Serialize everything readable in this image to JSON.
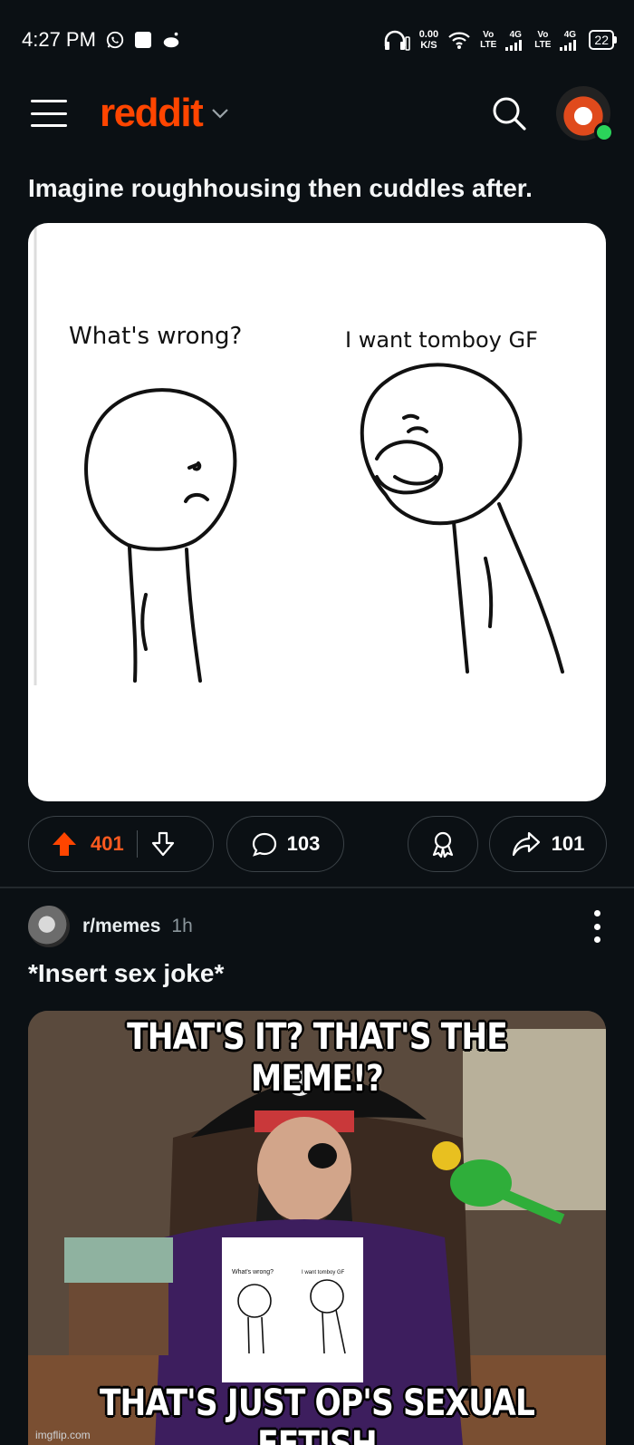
{
  "status": {
    "time": "4:27 PM",
    "speed_value": "0.00",
    "speed_unit": "K/S",
    "net1_top": "Vo",
    "net1_bottom": "LTE",
    "net1_gen": "4G",
    "net2_top": "Vo",
    "net2_bottom": "LTE",
    "net2_gen": "4G",
    "battery": "22"
  },
  "appbar": {
    "logo": "reddit",
    "icons": [
      "menu-icon",
      "chevron-down-icon",
      "search-icon",
      "avatar"
    ]
  },
  "post1": {
    "title": "Imagine roughhousing then cuddles after.",
    "image_caption_left": "What's wrong?",
    "image_caption_right": "I want tomboy GF",
    "upvotes": "401",
    "comments": "103",
    "shares": "101"
  },
  "post2": {
    "subreddit": "r/memes",
    "age": "1h",
    "title": "*Insert sex joke*",
    "image_top_text": "THAT'S IT? THAT'S THE MEME!?",
    "image_bottom_text": "THAT'S JUST OP'S SEXUAL FETISH",
    "image_inset_left": "What's wrong?",
    "image_inset_right": "I want tomboy GF",
    "watermark": "imgflip.com"
  },
  "colors": {
    "background": "#0b1014",
    "brand": "#ff4500",
    "upvote_active": "#ff5a1f",
    "online": "#2bd45a"
  }
}
